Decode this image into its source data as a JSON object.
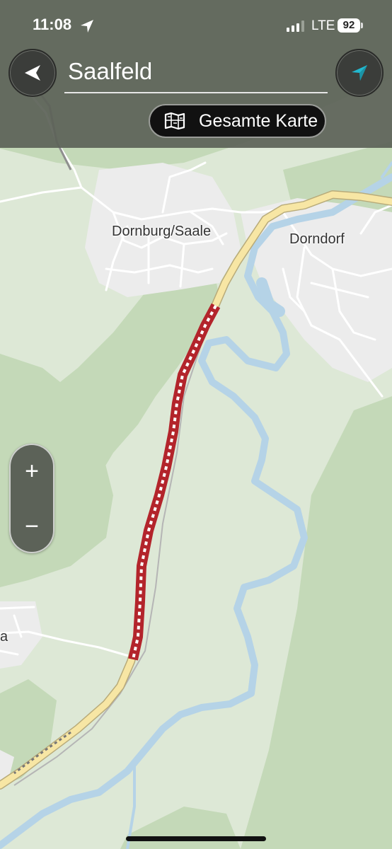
{
  "status_bar": {
    "time": "11:08",
    "network": "LTE",
    "battery": "92"
  },
  "header": {
    "destination": "Saalfeld",
    "overview_label": "Gesamte Karte"
  },
  "map": {
    "labels": {
      "dornburg": "Dornburg/Saale",
      "dorndorf": "Dorndorf",
      "west_partial": "a"
    },
    "colors": {
      "background": "#dde8d6",
      "forest": "#c4d9b8",
      "settlement": "#eeeeee",
      "road_main": "#f7e6a4",
      "water": "#b5d3e7",
      "closure_red": "#b3242b"
    }
  },
  "zoom": {
    "in_label": "+",
    "out_label": "−"
  },
  "icons": {
    "back": "back-arrow-icon",
    "navigate": "navigation-arrow-icon",
    "overview": "map-icon",
    "location": "location-arrow-icon"
  }
}
